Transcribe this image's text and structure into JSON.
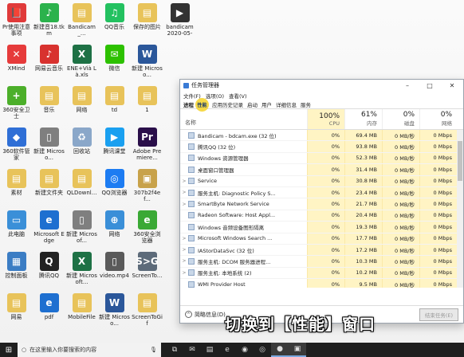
{
  "desktop_icons": [
    {
      "label": "Pr使用注意事项",
      "icon": "pr-icon",
      "color": "#e03a3a",
      "glyph": "📕"
    },
    {
      "label": "新建音18.tkm",
      "icon": "music-icon",
      "color": "#2bb24c",
      "glyph": "♪"
    },
    {
      "label": "Bandicam_...",
      "icon": "folder-icon",
      "color": "#e8c35a",
      "glyph": "▤"
    },
    {
      "label": "QQ音乐",
      "icon": "qqmusic-icon",
      "color": "#23c160",
      "glyph": "♫"
    },
    {
      "label": "保存的图片",
      "icon": "folder-icon",
      "color": "#e8c35a",
      "glyph": "▤"
    },
    {
      "label": "bandicam 2020-05-3...",
      "icon": "video-icon",
      "color": "#333333",
      "glyph": "▶"
    },
    {
      "label": "XMind",
      "icon": "xmind-icon",
      "color": "#e63b3b",
      "glyph": "✕"
    },
    {
      "label": "网易云音乐",
      "icon": "netease-icon",
      "color": "#d8322f",
      "glyph": "♪"
    },
    {
      "label": "ENE+Vià Là.xls",
      "icon": "excel-icon",
      "color": "#1e7145",
      "glyph": "X"
    },
    {
      "label": "微信",
      "icon": "wechat-icon",
      "color": "#2dc100",
      "glyph": "✉"
    },
    {
      "label": "新建 Microso...",
      "icon": "word-icon",
      "color": "#2b579a",
      "glyph": "W"
    },
    {
      "label": "",
      "icon": "blank",
      "color": "transparent",
      "glyph": ""
    },
    {
      "label": "360安全卫士",
      "icon": "360-icon",
      "color": "#4caf2a",
      "glyph": "+"
    },
    {
      "label": "音乐",
      "icon": "folder-icon",
      "color": "#e8c35a",
      "glyph": "▤"
    },
    {
      "label": "网络",
      "icon": "folder-icon",
      "color": "#e8c35a",
      "glyph": "▤"
    },
    {
      "label": "td",
      "icon": "folder-icon",
      "color": "#e8c35a",
      "glyph": "▤"
    },
    {
      "label": "1",
      "icon": "folder-icon",
      "color": "#e8c35a",
      "glyph": "▤"
    },
    {
      "label": "",
      "icon": "blank",
      "color": "transparent",
      "glyph": ""
    },
    {
      "label": "360软件管家",
      "icon": "360soft-icon",
      "color": "#2f6fd6",
      "glyph": "◆"
    },
    {
      "label": "新建 Microso...",
      "icon": "doc-icon",
      "color": "#7f7f7f",
      "glyph": "▯"
    },
    {
      "label": "回收站",
      "icon": "recycle-icon",
      "color": "#8aa7c9",
      "glyph": "♻"
    },
    {
      "label": "腾讯课堂",
      "icon": "tencent-class-icon",
      "color": "#1aa0f0",
      "glyph": "▶"
    },
    {
      "label": "Adobe Premiere...",
      "icon": "premiere-icon",
      "color": "#2a0f4a",
      "glyph": "Pr"
    },
    {
      "label": "",
      "icon": "blank",
      "color": "transparent",
      "glyph": ""
    },
    {
      "label": "素材",
      "icon": "folder-icon",
      "color": "#e8c35a",
      "glyph": "▤"
    },
    {
      "label": "新建文件夹",
      "icon": "folder-icon",
      "color": "#e8c35a",
      "glyph": "▤"
    },
    {
      "label": "QLDownl...",
      "icon": "folder-icon",
      "color": "#e8c35a",
      "glyph": "▤"
    },
    {
      "label": "QQ浏览器",
      "icon": "qqbrowser-icon",
      "color": "#1d7cf2",
      "glyph": "◎"
    },
    {
      "label": "307b2f4ef...",
      "icon": "image-icon",
      "color": "#c8a24a",
      "glyph": "▣"
    },
    {
      "label": "",
      "icon": "blank",
      "color": "transparent",
      "glyph": ""
    },
    {
      "label": "此电脑",
      "icon": "computer-icon",
      "color": "#3a8fd8",
      "glyph": "▭"
    },
    {
      "label": "Microsoft Edge",
      "icon": "edge-icon",
      "color": "#1e6fd0",
      "glyph": "e"
    },
    {
      "label": "新建 Microsof...",
      "icon": "doc-icon",
      "color": "#7f7f7f",
      "glyph": "▯"
    },
    {
      "label": "网络",
      "icon": "network-icon",
      "color": "#3a8fd8",
      "glyph": "⊕"
    },
    {
      "label": "360安全浏览器",
      "icon": "360browser-icon",
      "color": "#3aa935",
      "glyph": "e"
    },
    {
      "label": "",
      "icon": "blank",
      "color": "transparent",
      "glyph": ""
    },
    {
      "label": "控制面板",
      "icon": "control-panel-icon",
      "color": "#3b7dc4",
      "glyph": "▦"
    },
    {
      "label": "腾讯QQ",
      "icon": "qq-icon",
      "color": "#222222",
      "glyph": "Q"
    },
    {
      "label": "新建 Microsoft...",
      "icon": "excel-icon",
      "color": "#1e7145",
      "glyph": "X"
    },
    {
      "label": "video.mp4",
      "icon": "video-file-icon",
      "color": "#5a5a5a",
      "glyph": "▯"
    },
    {
      "label": "ScreenTo...",
      "icon": "screentogif-icon",
      "color": "#5d6b7a",
      "glyph": "S>G"
    },
    {
      "label": "",
      "icon": "blank",
      "color": "transparent",
      "glyph": ""
    },
    {
      "label": "网易",
      "icon": "folder-icon",
      "color": "#e8c35a",
      "glyph": "▤"
    },
    {
      "label": "pdf",
      "icon": "pdf-edge-icon",
      "color": "#1e6fd0",
      "glyph": "e"
    },
    {
      "label": "MobileFile",
      "icon": "folder-icon",
      "color": "#e8c35a",
      "glyph": "▤"
    },
    {
      "label": "新建 Microso...",
      "icon": "word-icon",
      "color": "#2b579a",
      "glyph": "W"
    },
    {
      "label": "ScreenToGif",
      "icon": "folder-icon",
      "color": "#e8c35a",
      "glyph": "▤"
    }
  ],
  "task_manager": {
    "title": "任务管理器",
    "controls": {
      "minimize": "–",
      "maximize": "□",
      "close": "✕"
    },
    "menu": [
      "文件(F)",
      "选项(O)",
      "查看(V)"
    ],
    "tabs": [
      "进程",
      "性能",
      "应用历史记录",
      "启动",
      "用户",
      "详细信息",
      "服务"
    ],
    "highlight_label": "性能",
    "columns": {
      "name": "名称",
      "cpu": {
        "pct": "100%",
        "caption": "CPU"
      },
      "memory": {
        "pct": "61%",
        "caption": "内存"
      },
      "disk": {
        "pct": "0%",
        "caption": "磁盘"
      },
      "network": {
        "pct": "0%",
        "caption": "网络"
      }
    },
    "rows": [
      {
        "expand": "",
        "name": "Bandicam - bdcam.exe (32 位)",
        "cpu": "0%",
        "mem": "69.4 MB",
        "disk": "0 MB/秒",
        "net": "0 Mbps"
      },
      {
        "expand": "",
        "name": "腾讯QQ (32 位)",
        "cpu": "0%",
        "mem": "93.8 MB",
        "disk": "0 MB/秒",
        "net": "0 Mbps"
      },
      {
        "expand": "",
        "name": "Windows 资源管理器",
        "cpu": "0%",
        "mem": "52.3 MB",
        "disk": "0 MB/秒",
        "net": "0 Mbps"
      },
      {
        "expand": "",
        "name": "桌面窗口管理器",
        "cpu": "0%",
        "mem": "31.4 MB",
        "disk": "0 MB/秒",
        "net": "0 Mbps"
      },
      {
        "expand": ">",
        "name": "Service",
        "cpu": "0%",
        "mem": "30.8 MB",
        "disk": "0 MB/秒",
        "net": "0 Mbps"
      },
      {
        "expand": ">",
        "name": "服务主机: Diagnostic Policy S...",
        "cpu": "0%",
        "mem": "23.4 MB",
        "disk": "0 MB/秒",
        "net": "0 Mbps"
      },
      {
        "expand": ">",
        "name": "SmartByte Network Service",
        "cpu": "0%",
        "mem": "21.7 MB",
        "disk": "0 MB/秒",
        "net": "0 Mbps"
      },
      {
        "expand": "",
        "name": "Radeon Software: Host Appl...",
        "cpu": "0%",
        "mem": "20.4 MB",
        "disk": "0 MB/秒",
        "net": "0 Mbps"
      },
      {
        "expand": "",
        "name": "Windows 音频设备图形隔离",
        "cpu": "0%",
        "mem": "19.3 MB",
        "disk": "0 MB/秒",
        "net": "0 Mbps"
      },
      {
        "expand": ">",
        "name": "Microsoft Windows Search ...",
        "cpu": "0%",
        "mem": "17.7 MB",
        "disk": "0 MB/秒",
        "net": "0 Mbps"
      },
      {
        "expand": ">",
        "name": "IAStorDataSvc (32 位)",
        "cpu": "0%",
        "mem": "17.2 MB",
        "disk": "0 MB/秒",
        "net": "0 Mbps"
      },
      {
        "expand": ">",
        "name": "服务主机: DCOM 服务器进程...",
        "cpu": "0%",
        "mem": "10.3 MB",
        "disk": "0 MB/秒",
        "net": "0 Mbps"
      },
      {
        "expand": ">",
        "name": "服务主机: 本地系统 (2)",
        "cpu": "0%",
        "mem": "10.2 MB",
        "disk": "0 MB/秒",
        "net": "0 Mbps"
      },
      {
        "expand": "",
        "name": "WMI Provider Host",
        "cpu": "0%",
        "mem": "9.5 MB",
        "disk": "0 MB/秒",
        "net": "0 Mbps"
      }
    ],
    "footer": {
      "less": "简略信息(D)",
      "end_task": "结束任务(E)"
    }
  },
  "caption": "切换到【性能】窗口",
  "taskbar": {
    "search_placeholder": "在这里输入你要搜索的内容",
    "apps": [
      {
        "name": "task-view-icon",
        "glyph": "⧉"
      },
      {
        "name": "mail-icon",
        "glyph": "✉"
      },
      {
        "name": "folder-icon",
        "glyph": "▤"
      },
      {
        "name": "edge-icon",
        "glyph": "e"
      },
      {
        "name": "chrome-icon",
        "glyph": "◉"
      },
      {
        "name": "360browser-icon",
        "glyph": "◎"
      },
      {
        "name": "bandicam-icon",
        "glyph": "●"
      },
      {
        "name": "task-manager-icon",
        "glyph": "▣"
      }
    ]
  }
}
